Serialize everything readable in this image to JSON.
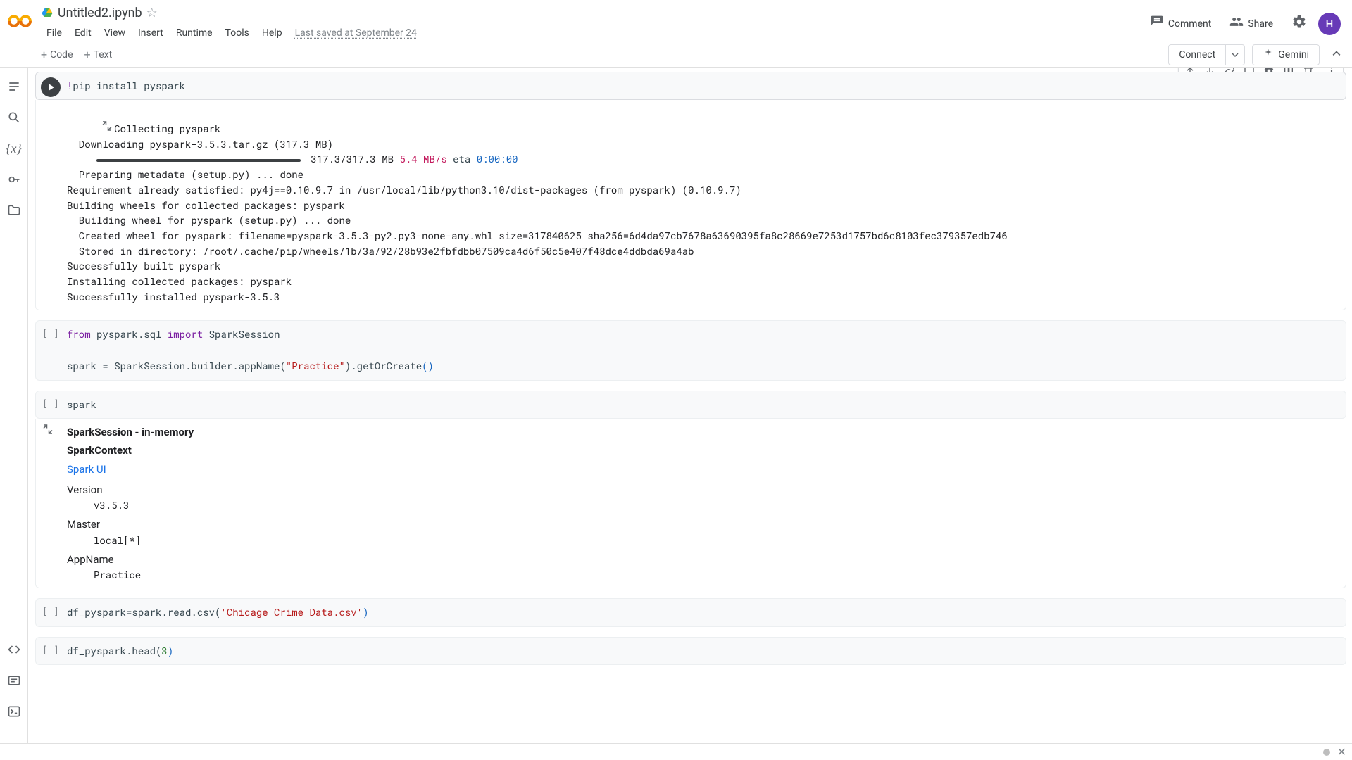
{
  "header": {
    "file_name": "Untitled2.ipynb",
    "last_saved": "Last saved at September 24",
    "comment_label": "Comment",
    "share_label": "Share",
    "avatar_initial": "H"
  },
  "menu": {
    "file": "File",
    "edit": "Edit",
    "view": "View",
    "insert": "Insert",
    "runtime": "Runtime",
    "tools": "Tools",
    "help": "Help"
  },
  "toolbar": {
    "code_label": "Code",
    "text_label": "Text",
    "connect_label": "Connect",
    "gemini_label": "Gemini"
  },
  "cells": {
    "c0": {
      "code_plain": "!pip install pyspark"
    },
    "out0": {
      "l1": "Collecting pyspark",
      "l2": "  Downloading pyspark-3.5.3.tar.gz (317.3 MB)",
      "progress_text": "317.3/317.3 MB",
      "rate": "5.4 MB/s",
      "eta_label": "eta",
      "eta_value": "0:00:00",
      "l4": "  Preparing metadata (setup.py) ... done",
      "l5": "Requirement already satisfied: py4j==0.10.9.7 in /usr/local/lib/python3.10/dist-packages (from pyspark) (0.10.9.7)",
      "l6": "Building wheels for collected packages: pyspark",
      "l7": "  Building wheel for pyspark (setup.py) ... done",
      "l8": "  Created wheel for pyspark: filename=pyspark-3.5.3-py2.py3-none-any.whl size=317840625 sha256=6d4da97cb7678a63690395fa8c28669e7253d1757bd6c8103fec379357edb746",
      "l9": "  Stored in directory: /root/.cache/pip/wheels/1b/3a/92/28b93e2fbfdbb07509ca4d6f50c5e407f48dce4ddbda69a4ab",
      "l10": "Successfully built pyspark",
      "l11": "Installing collected packages: pyspark",
      "l12": "Successfully installed pyspark-3.5.3"
    },
    "c1": {
      "kw_from": "from",
      "mod": " pyspark.sql ",
      "kw_import": "import",
      "cls": " SparkSession",
      "line2a": "spark = SparkSession.builder.appName(",
      "str": "\"Practice\"",
      "line2b": ").getOrCreate",
      "paren": "()"
    },
    "c2": {
      "code": "spark"
    },
    "out2": {
      "title": "SparkSession - in-memory",
      "subtitle": "SparkContext",
      "link": "Spark UI",
      "version_label": "Version",
      "version_value": "v3.5.3",
      "master_label": "Master",
      "master_value": "local[*]",
      "app_label": "AppName",
      "app_value": "Practice"
    },
    "c3": {
      "a": "df_pyspark=spark.read.csv(",
      "str": "'Chicage Crime Data.csv'",
      "b": ")"
    },
    "c4": {
      "a": "df_pyspark.head(",
      "num": "3",
      "b": ")"
    },
    "bracket": "[ ]"
  }
}
